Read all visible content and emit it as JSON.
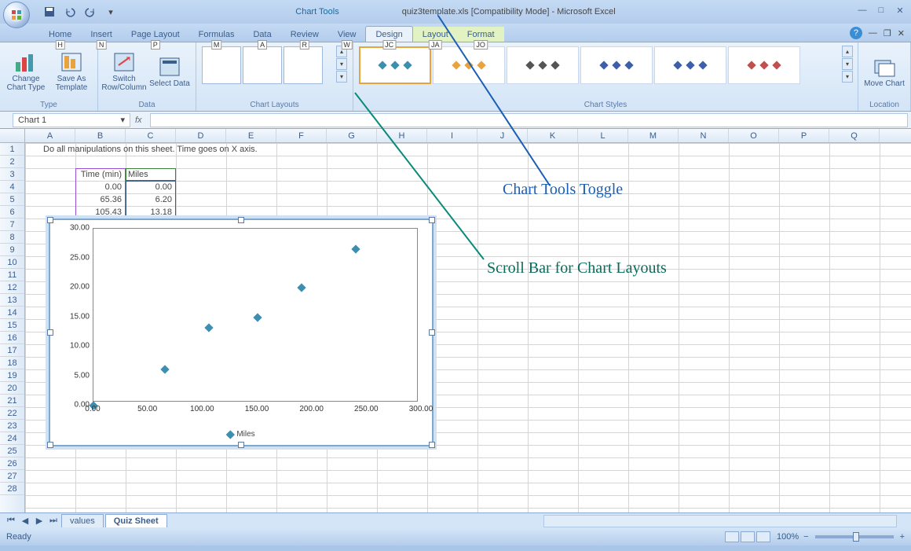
{
  "title": {
    "chart_tools": "Chart Tools",
    "document": "quiz3template.xls  [Compatibility Mode] - Microsoft Excel"
  },
  "tabs": [
    "Home",
    "Insert",
    "Page Layout",
    "Formulas",
    "Data",
    "Review",
    "View",
    "Design",
    "Layout",
    "Format"
  ],
  "tab_keytips": [
    "H",
    "N",
    "P",
    "M",
    "A",
    "R",
    "W",
    "JC",
    "JA",
    "JO"
  ],
  "ribbon": {
    "type_group": "Type",
    "change_chart": "Change Chart Type",
    "save_template": "Save As Template",
    "data_group": "Data",
    "switch": "Switch Row/Column",
    "select_data": "Select Data",
    "layouts_group": "Chart Layouts",
    "styles_group": "Chart Styles",
    "location_group": "Location",
    "move_chart": "Move Chart"
  },
  "namebox": "Chart 1",
  "columns": [
    "A",
    "B",
    "C",
    "D",
    "E",
    "F",
    "G",
    "H",
    "I",
    "J",
    "K",
    "L",
    "M",
    "N",
    "O",
    "P",
    "Q"
  ],
  "rows_count": 28,
  "cells": {
    "instruction": "Do all manipulations on this sheet.  Time goes on X axis.",
    "hdr_time": "Time (min)",
    "hdr_miles": "Miles",
    "r4b": "0.00",
    "r4c": "0.00",
    "r5b": "65.36",
    "r5c": "6.20",
    "r6b": "105.43",
    "r6c": "13.18"
  },
  "chart_data": {
    "type": "scatter",
    "series": [
      {
        "name": "Miles",
        "x": [
          0,
          65.36,
          105.43,
          150,
          190,
          240
        ],
        "y": [
          0,
          6.2,
          13.18,
          15,
          20,
          26.5
        ]
      }
    ],
    "xlabel": "",
    "ylabel": "",
    "xlim": [
      0,
      300
    ],
    "ylim": [
      0,
      30
    ],
    "xticks": [
      0,
      50,
      100,
      150,
      200,
      250,
      300
    ],
    "yticks": [
      0,
      5,
      10,
      15,
      20,
      25,
      30
    ],
    "xtick_labels": [
      "0.00",
      "50.00",
      "100.00",
      "150.00",
      "200.00",
      "250.00",
      "300.00"
    ],
    "ytick_labels": [
      "0.00",
      "5.00",
      "10.00",
      "15.00",
      "20.00",
      "25.00",
      "30.00"
    ],
    "legend": "Miles"
  },
  "annotations": {
    "toggle": "Chart Tools Toggle",
    "scrollbar": "Scroll Bar for Chart Layouts"
  },
  "sheets": {
    "tab1": "values",
    "tab2": "Quiz Sheet"
  },
  "status": {
    "ready": "Ready",
    "zoom": "100%"
  }
}
